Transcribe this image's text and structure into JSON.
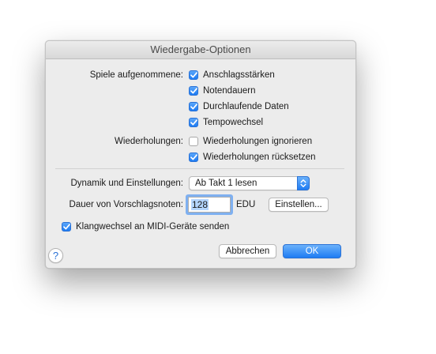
{
  "window": {
    "title": "Wiedergabe-Optionen"
  },
  "recorded": {
    "label": "Spiele aufgenommene:",
    "options": [
      {
        "label": "Anschlagsstärken",
        "checked": true
      },
      {
        "label": "Notendauern",
        "checked": true
      },
      {
        "label": "Durchlaufende Daten",
        "checked": true
      },
      {
        "label": "Tempowechsel",
        "checked": true
      }
    ]
  },
  "repeats": {
    "label": "Wiederholungen:",
    "options": [
      {
        "label": "Wiederholungen ignorieren",
        "checked": false
      },
      {
        "label": "Wiederholungen rücksetzen",
        "checked": true
      }
    ]
  },
  "dynamics": {
    "label": "Dynamik und Einstellungen:",
    "selected": "Ab Takt 1 lesen"
  },
  "grace": {
    "label": "Dauer von Vorschlagsnoten:",
    "value": "128",
    "unit": "EDU",
    "settings_button": "Einstellen..."
  },
  "midi": {
    "label": "Klangwechsel an MIDI-Geräte senden",
    "checked": true
  },
  "buttons": {
    "help": "?",
    "cancel": "Abbrechen",
    "ok": "OK"
  },
  "colors": {
    "accent": "#1e7cf3",
    "focus_ring": "#7fb0f0"
  }
}
